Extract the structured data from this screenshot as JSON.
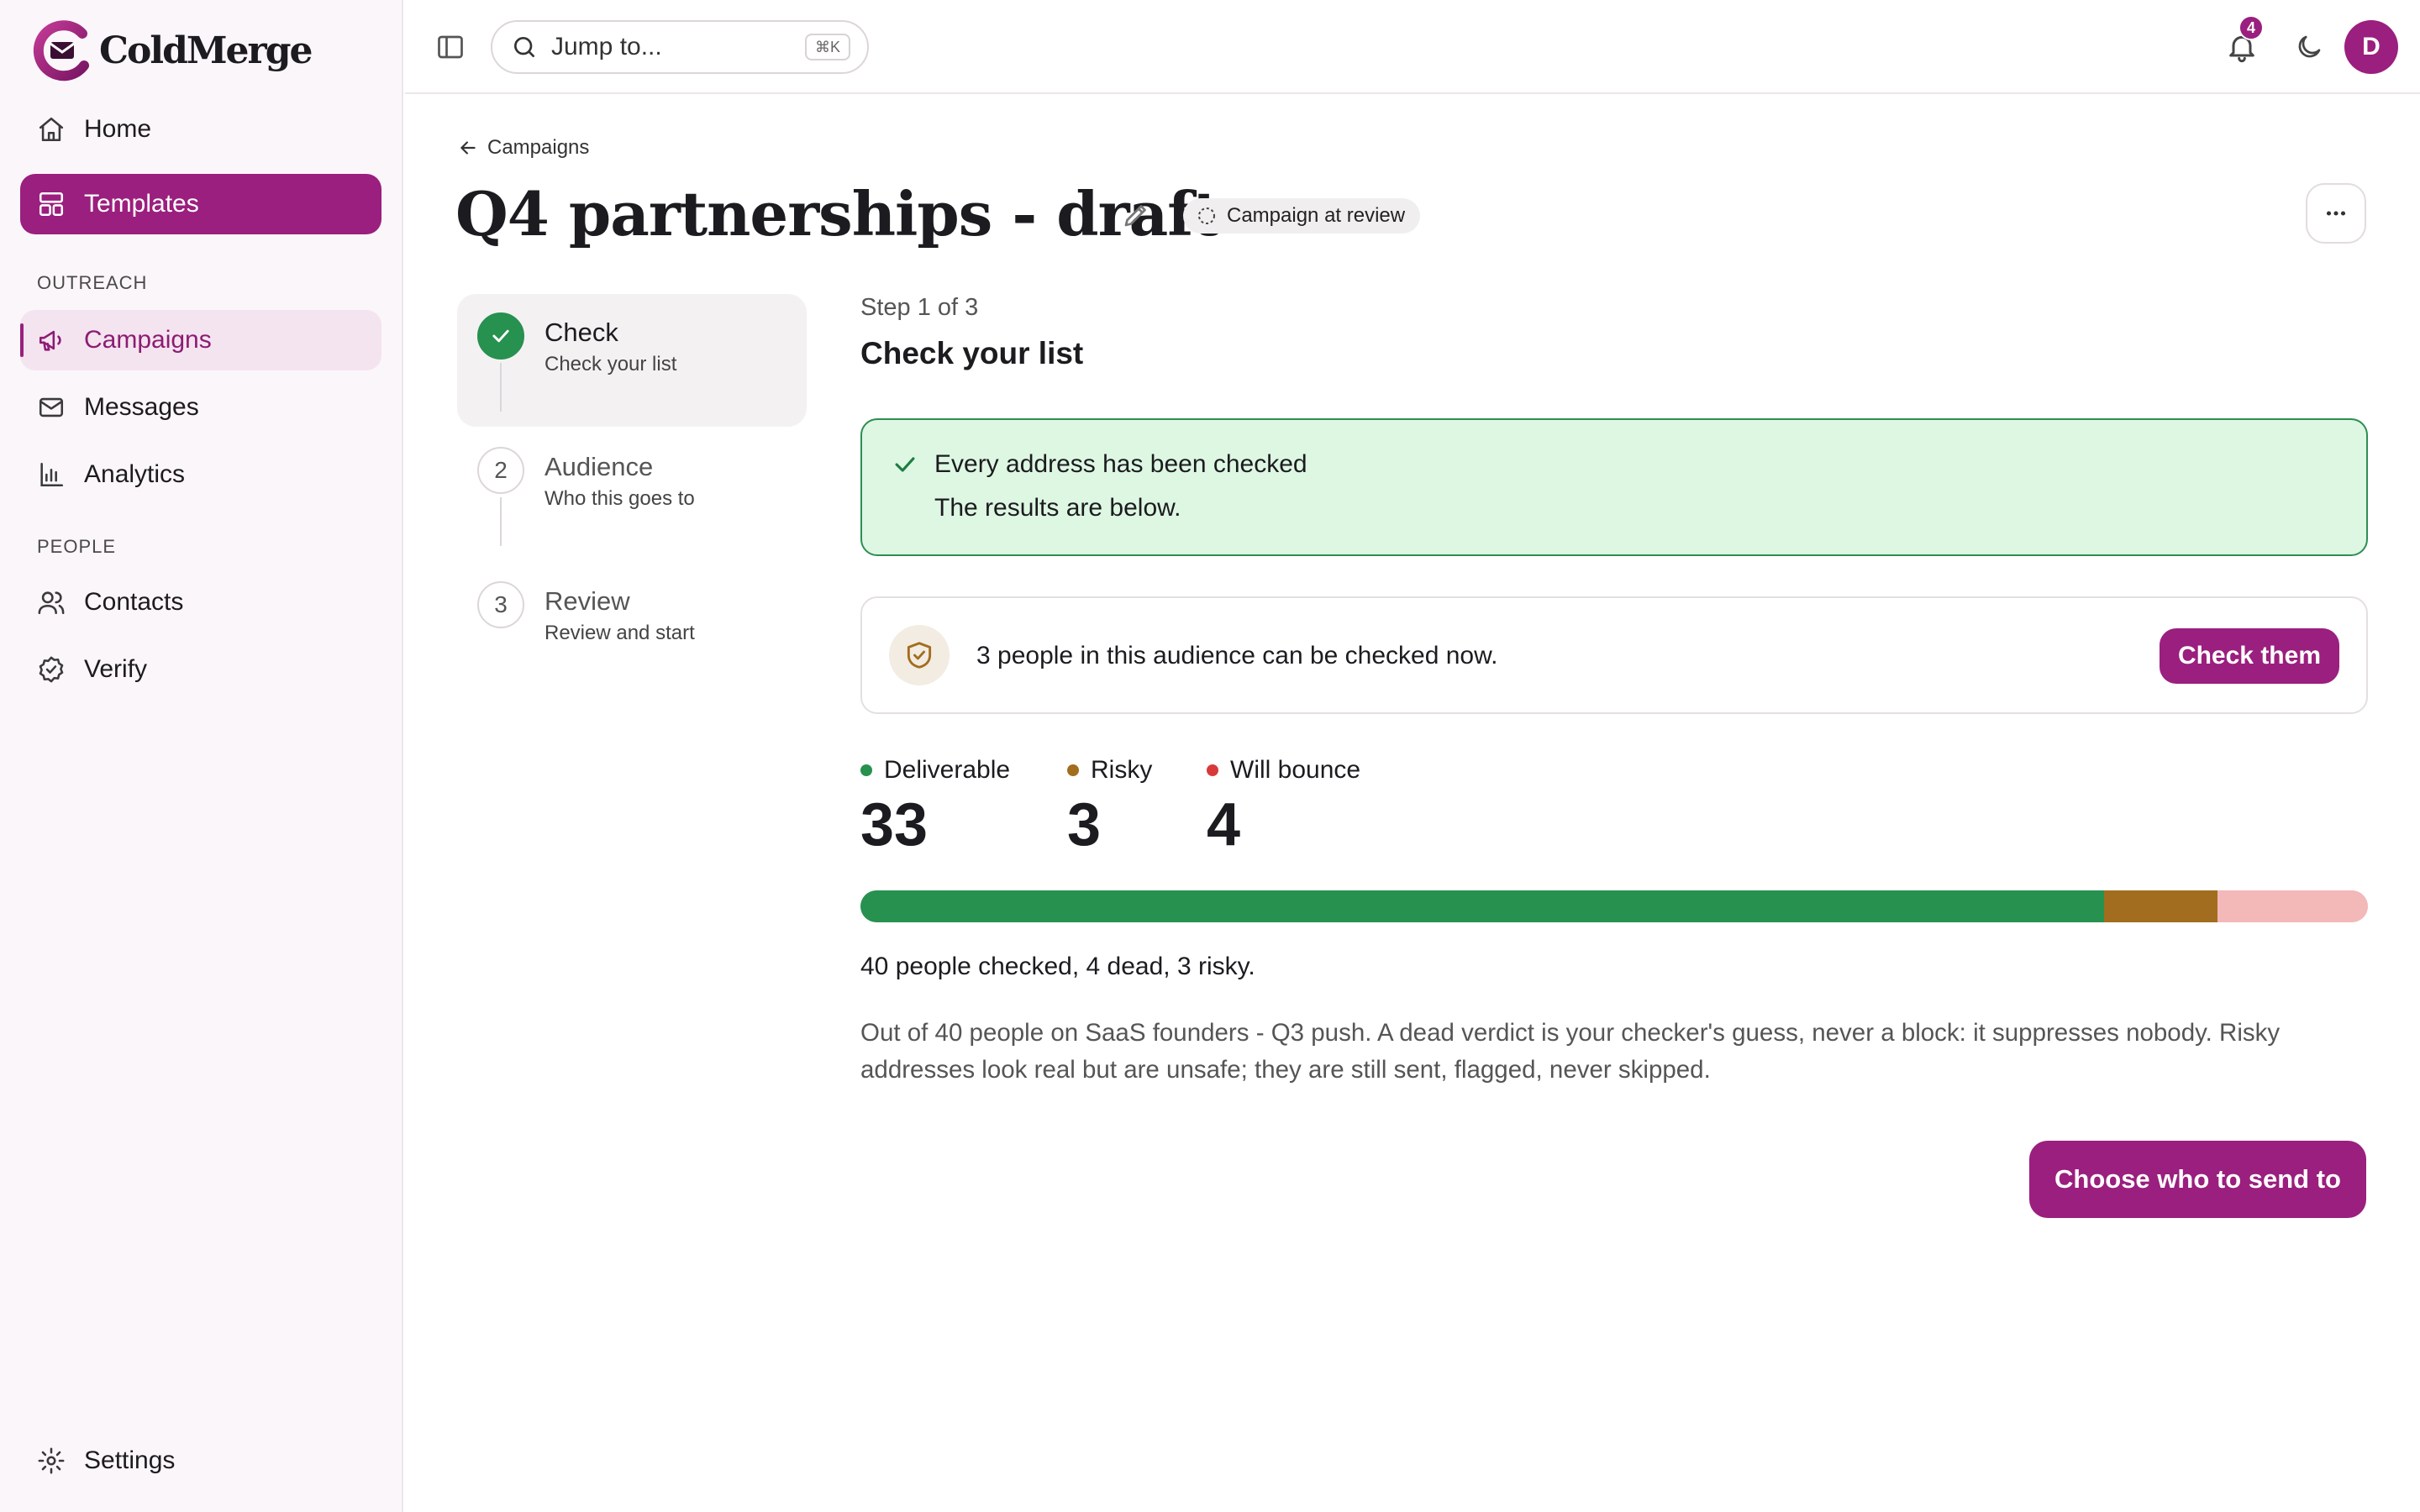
{
  "app": {
    "name": "ColdMerge",
    "brand_color": "#9a1f7e"
  },
  "sidebar": {
    "items": [
      {
        "label": "Home",
        "icon": "home-icon"
      },
      {
        "label": "Templates",
        "icon": "layout-icon",
        "state": "selected"
      }
    ],
    "sections": [
      {
        "label": "OUTREACH",
        "items": [
          {
            "label": "Campaigns",
            "icon": "megaphone-icon",
            "state": "current"
          },
          {
            "label": "Messages",
            "icon": "mail-icon"
          },
          {
            "label": "Analytics",
            "icon": "bar-chart-icon"
          }
        ]
      },
      {
        "label": "PEOPLE",
        "items": [
          {
            "label": "Contacts",
            "icon": "users-icon"
          },
          {
            "label": "Verify",
            "icon": "badge-check-icon"
          }
        ]
      }
    ],
    "footer": {
      "label": "Settings",
      "icon": "gear-icon"
    }
  },
  "topbar": {
    "search_placeholder": "Jump to...",
    "search_shortcut": "⌘K",
    "notification_count": "4",
    "avatar_initial": "D"
  },
  "page": {
    "breadcrumb": "Campaigns",
    "title": "Q4 partnerships - draft",
    "status": "Campaign at review"
  },
  "stepper": [
    {
      "number": "1",
      "title": "Check",
      "subtitle": "Check your list",
      "state": "done"
    },
    {
      "number": "2",
      "title": "Audience",
      "subtitle": "Who this goes to",
      "state": "upcoming"
    },
    {
      "number": "3",
      "title": "Review",
      "subtitle": "Review and start",
      "state": "upcoming"
    }
  ],
  "content": {
    "step_counter": "Step 1 of 3",
    "heading": "Check your list",
    "success": {
      "title": "Every address has been checked",
      "subtitle": "The results are below."
    },
    "info": {
      "text": "3 people in this audience can be checked now.",
      "button": "Check them"
    },
    "stats": [
      {
        "label": "Deliverable",
        "value": 33,
        "color": "#27914f"
      },
      {
        "label": "Risky",
        "value": 3,
        "color": "#a26d1e"
      },
      {
        "label": "Will bounce",
        "value": 4,
        "color": "#d83a3a"
      }
    ],
    "bar_segments": [
      {
        "name": "deliverable",
        "value": 33,
        "color": "#27914f"
      },
      {
        "name": "risky",
        "value": 3,
        "color": "#a26d1e"
      },
      {
        "name": "will-bounce",
        "value": 4,
        "color": "#f3b8b8"
      }
    ],
    "summary": "40 people checked, 4 dead, 3 risky.",
    "description": "Out of 40 people on SaaS founders - Q3 push. A dead verdict is your checker's guess, never a block: it suppresses nobody. Risky addresses look real but are unsafe; they are still sent, flagged, never skipped.",
    "primary_button": "Choose who to send to"
  }
}
